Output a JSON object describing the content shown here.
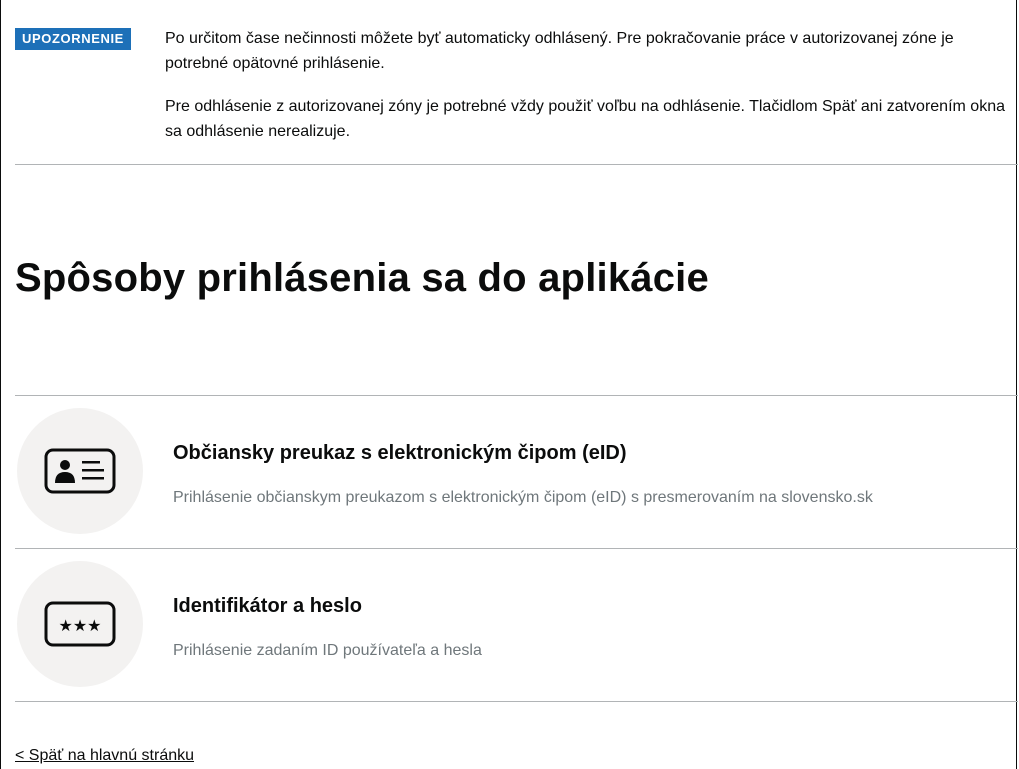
{
  "warning": {
    "tag": "UPOZORNENIE",
    "paragraph1": "Po určitom čase nečinnosti môžete byť automaticky odhlásený. Pre pokračovanie práce v autorizovanej zóne je potrebné opätovné prihlásenie.",
    "paragraph2": "Pre odhlásenie z autorizovanej zóny je potrebné vždy použiť voľbu na odhlásenie. Tlačidlom Späť ani zatvorením okna sa odhlásenie nerealizuje.",
    "tag_color": "#1d70b8"
  },
  "page_title": "Spôsoby prihlásenia sa do aplikácie",
  "methods": [
    {
      "icon": "id-card-icon",
      "title": "Občiansky preukaz s elektronickým čipom (eID)",
      "description": "Prihlásenie občianskym preukazom s elektronickým čipom (eID) s presmerovaním na slovensko.sk"
    },
    {
      "icon": "password-icon",
      "title": "Identifikátor a heslo",
      "description": "Prihlásenie zadaním ID používateľa a hesla"
    }
  ],
  "back_link": "< Späť na hlavnú stránku"
}
